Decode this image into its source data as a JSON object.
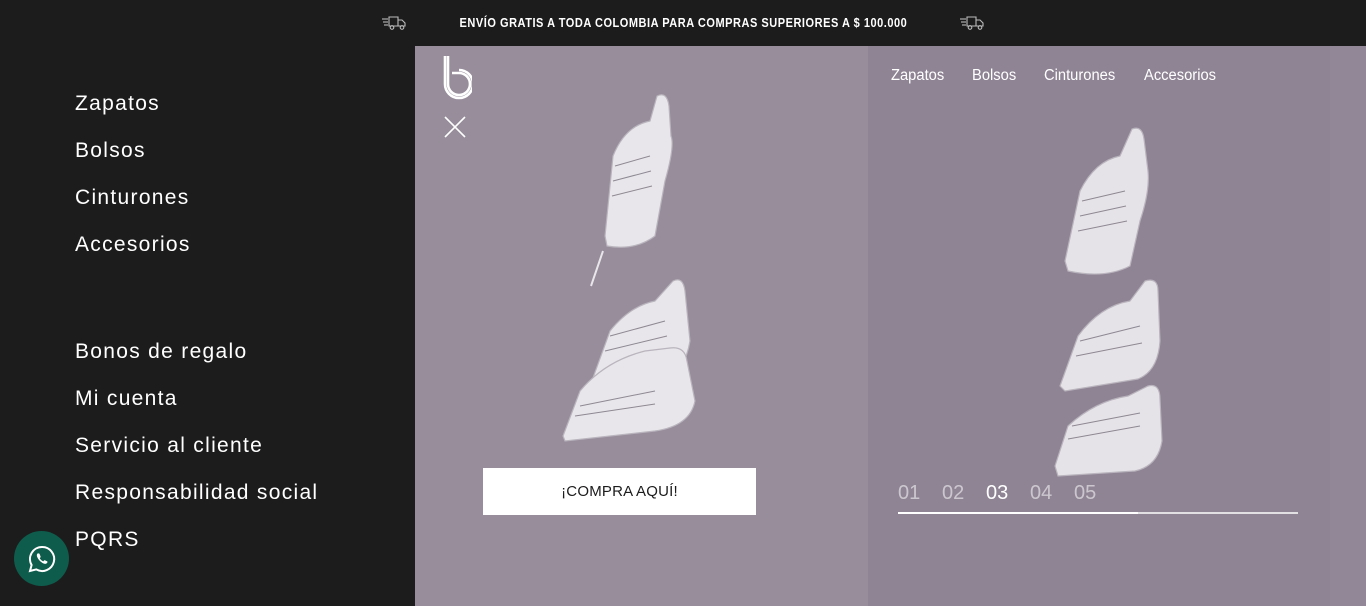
{
  "topbar": {
    "promo": "ENVÍO GRATIS A TODA COLOMBIA PARA COMPRAS SUPERIORES A $ 100.000",
    "icon_left": "truck-icon",
    "icon_right": "truck-icon"
  },
  "side_menu": {
    "primary": [
      "Zapatos",
      "Bolsos",
      "Cinturones",
      "Accesorios"
    ],
    "secondary": [
      "Bonos de regalo",
      "Mi cuenta",
      "Servicio al cliente",
      "Responsabilidad social",
      "PQRS"
    ]
  },
  "hero": {
    "nav": [
      "Zapatos",
      "Bolsos",
      "Cinturones",
      "Accesorios"
    ],
    "cta_label": "¡COMPRA AQUÍ!",
    "slides": [
      "01",
      "02",
      "03",
      "04",
      "05"
    ],
    "active_slide": "03",
    "progress": 0.6
  },
  "colors": {
    "dark": "#1d1c1d",
    "hero_bg": "#958a9a",
    "whatsapp": "#0d5c4c",
    "white": "#ffffff"
  },
  "icons": {
    "logo": "brand-b-logo",
    "close": "close-icon",
    "whatsapp": "whatsapp-icon"
  }
}
